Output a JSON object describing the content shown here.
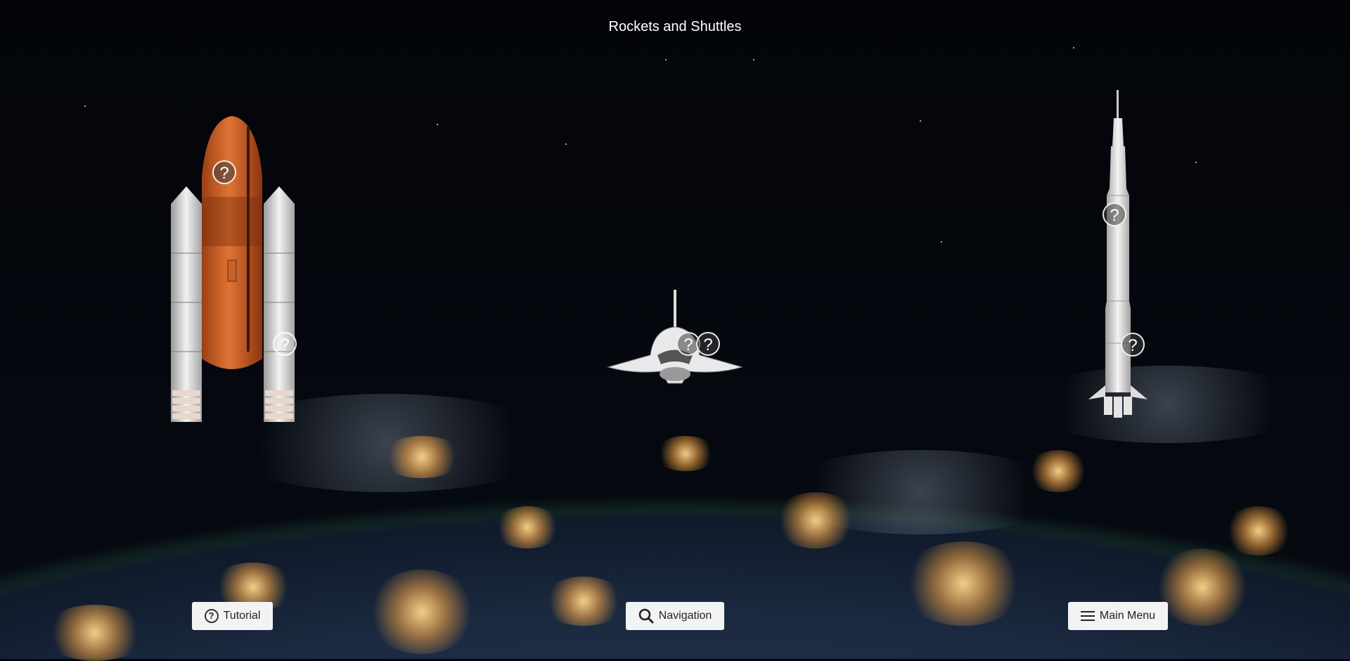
{
  "title": "Rockets and Shuttles",
  "hotspots": {
    "glyph": "?"
  },
  "buttons": {
    "tutorial": "Tutorial",
    "navigation": "Navigation",
    "main_menu": "Main Menu"
  },
  "icons": {
    "tutorial": "question-circle-icon",
    "navigation": "search-icon",
    "main_menu": "hamburger-menu-icon"
  },
  "colors": {
    "button_bg": "#f2f3f5",
    "external_tank": "#d2652a",
    "space_background": "#04070d"
  }
}
